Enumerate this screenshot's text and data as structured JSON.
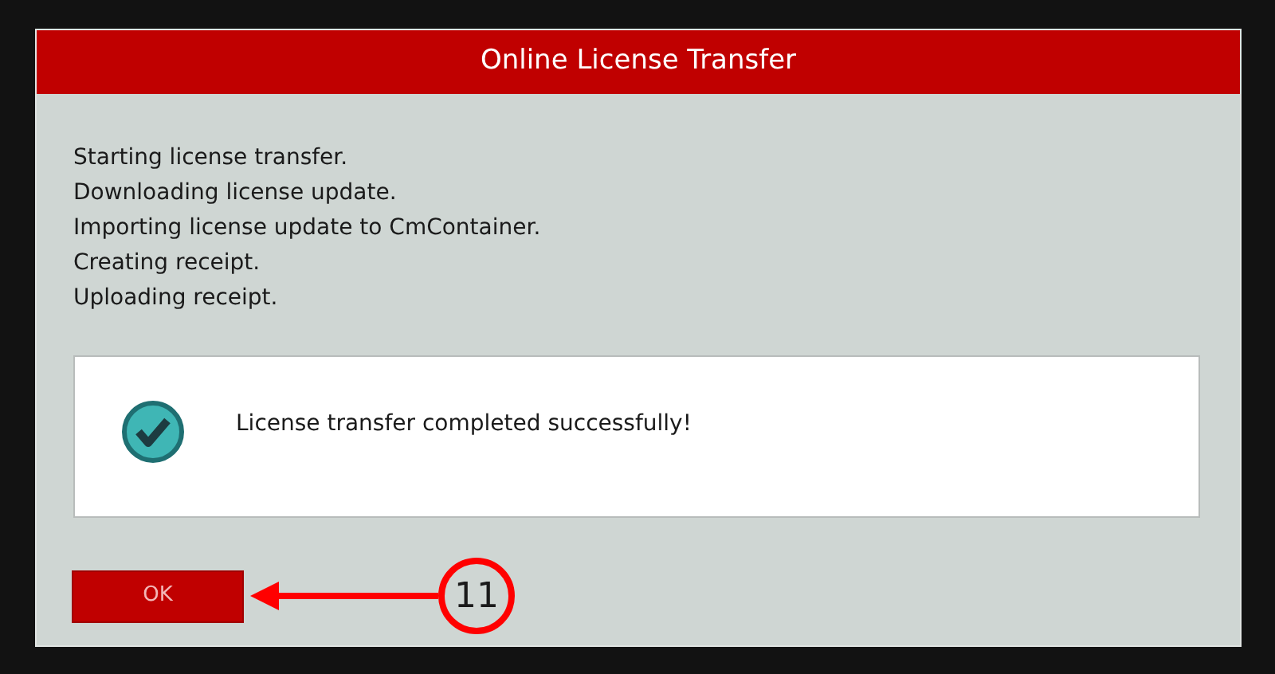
{
  "dialog": {
    "title": "Online License Transfer",
    "log_lines": [
      "Starting license transfer.",
      "Downloading license update.",
      "Importing license update to CmContainer.",
      "Creating receipt.",
      "Uploading receipt."
    ],
    "message": {
      "kind": "success",
      "text": "License transfer completed successfully!"
    },
    "buttons": [
      "OK"
    ]
  },
  "callout": {
    "number": "11"
  }
}
